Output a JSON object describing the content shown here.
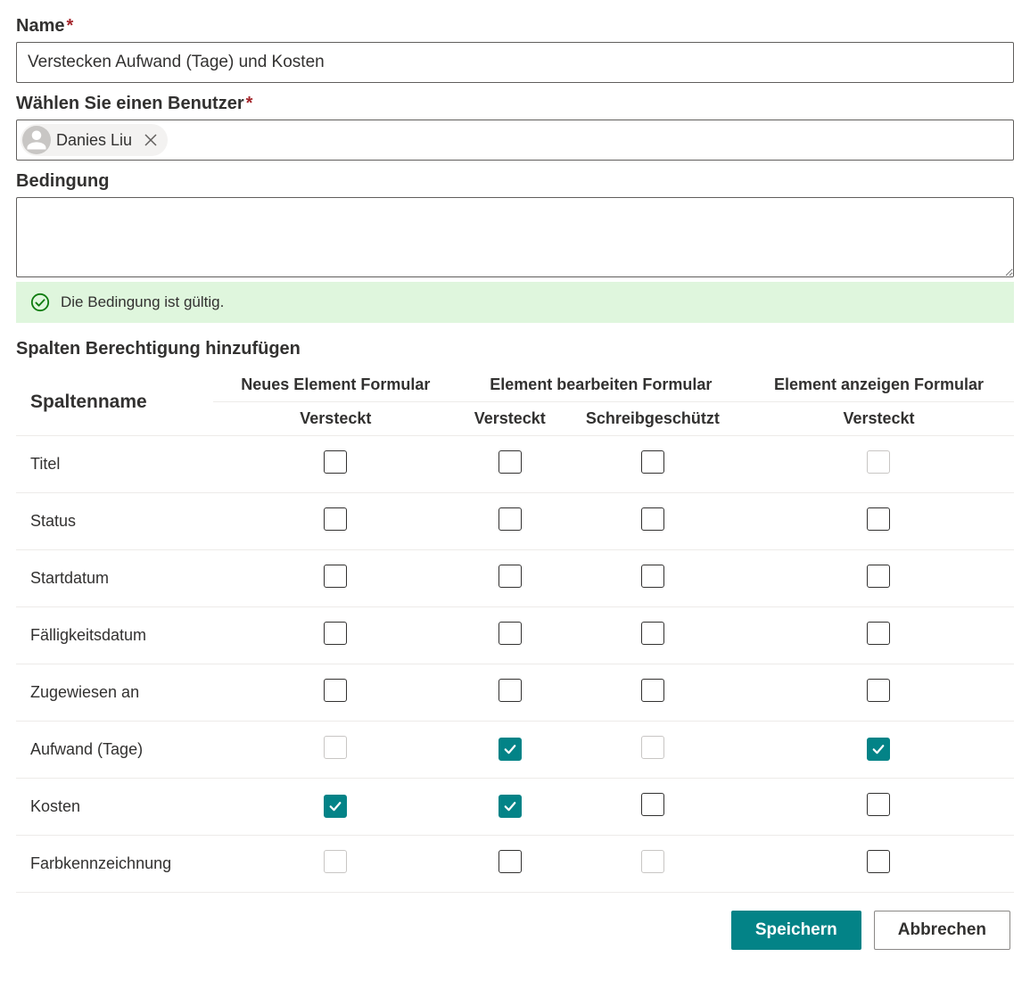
{
  "labels": {
    "name": "Name",
    "user": "Wählen Sie einen Benutzer",
    "condition": "Bedingung",
    "validation": "Die Bedingung ist gültig.",
    "section": "Spalten Berechtigung hinzufügen"
  },
  "fields": {
    "name_value": "Verstecken Aufwand (Tage) und Kosten",
    "user_chip": "Danies Liu",
    "condition_value": ""
  },
  "table": {
    "headers": {
      "colname": "Spaltenname",
      "new_form": "Neues Element Formular",
      "edit_form": "Element bearbeiten Formular",
      "view_form": "Element anzeigen Formular",
      "hidden": "Versteckt",
      "readonly": "Schreibgeschützt"
    },
    "rows": [
      {
        "name": "Titel",
        "new_hidden": {
          "c": false,
          "d": false
        },
        "edit_hidden": {
          "c": false,
          "d": false
        },
        "edit_ro": {
          "c": false,
          "d": false
        },
        "view_hidden": {
          "c": false,
          "d": true
        }
      },
      {
        "name": "Status",
        "new_hidden": {
          "c": false,
          "d": false
        },
        "edit_hidden": {
          "c": false,
          "d": false
        },
        "edit_ro": {
          "c": false,
          "d": false
        },
        "view_hidden": {
          "c": false,
          "d": false
        }
      },
      {
        "name": "Startdatum",
        "new_hidden": {
          "c": false,
          "d": false
        },
        "edit_hidden": {
          "c": false,
          "d": false
        },
        "edit_ro": {
          "c": false,
          "d": false
        },
        "view_hidden": {
          "c": false,
          "d": false
        }
      },
      {
        "name": "Fälligkeitsdatum",
        "new_hidden": {
          "c": false,
          "d": false
        },
        "edit_hidden": {
          "c": false,
          "d": false
        },
        "edit_ro": {
          "c": false,
          "d": false
        },
        "view_hidden": {
          "c": false,
          "d": false
        }
      },
      {
        "name": "Zugewiesen an",
        "new_hidden": {
          "c": false,
          "d": false
        },
        "edit_hidden": {
          "c": false,
          "d": false
        },
        "edit_ro": {
          "c": false,
          "d": false
        },
        "view_hidden": {
          "c": false,
          "d": false
        }
      },
      {
        "name": "Aufwand (Tage)",
        "new_hidden": {
          "c": false,
          "d": true
        },
        "edit_hidden": {
          "c": true,
          "d": false
        },
        "edit_ro": {
          "c": false,
          "d": true
        },
        "view_hidden": {
          "c": true,
          "d": false
        }
      },
      {
        "name": "Kosten",
        "new_hidden": {
          "c": true,
          "d": false
        },
        "edit_hidden": {
          "c": true,
          "d": false
        },
        "edit_ro": {
          "c": false,
          "d": false
        },
        "view_hidden": {
          "c": false,
          "d": false
        }
      },
      {
        "name": "Farbkennzeichnung",
        "new_hidden": {
          "c": false,
          "d": true
        },
        "edit_hidden": {
          "c": false,
          "d": false
        },
        "edit_ro": {
          "c": false,
          "d": true
        },
        "view_hidden": {
          "c": false,
          "d": false
        }
      }
    ]
  },
  "buttons": {
    "save": "Speichern",
    "cancel": "Abbrechen"
  }
}
